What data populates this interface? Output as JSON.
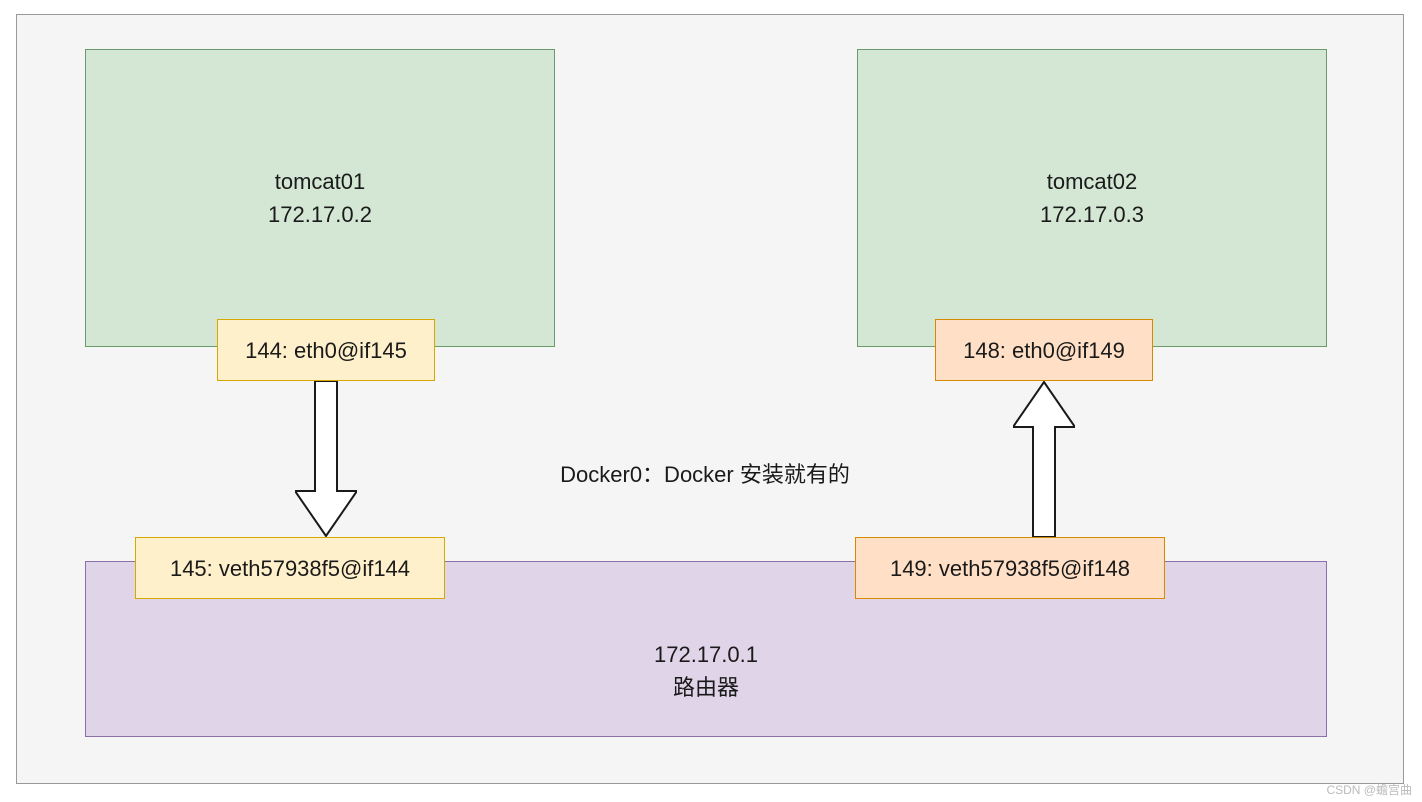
{
  "container1": {
    "name": "tomcat01",
    "ip": "172.17.0.2"
  },
  "container2": {
    "name": "tomcat02",
    "ip": "172.17.0.3"
  },
  "if1": "144: eth0@if145",
  "if2": "148: eth0@if149",
  "veth1": "145: veth57938f5@if144",
  "veth2": "149: veth57938f5@if148",
  "center_label": "Docker0：Docker 安装就有的",
  "router": {
    "ip": "172.17.0.1",
    "label": "路由器"
  },
  "watermark": "CSDN @蟾宫曲"
}
